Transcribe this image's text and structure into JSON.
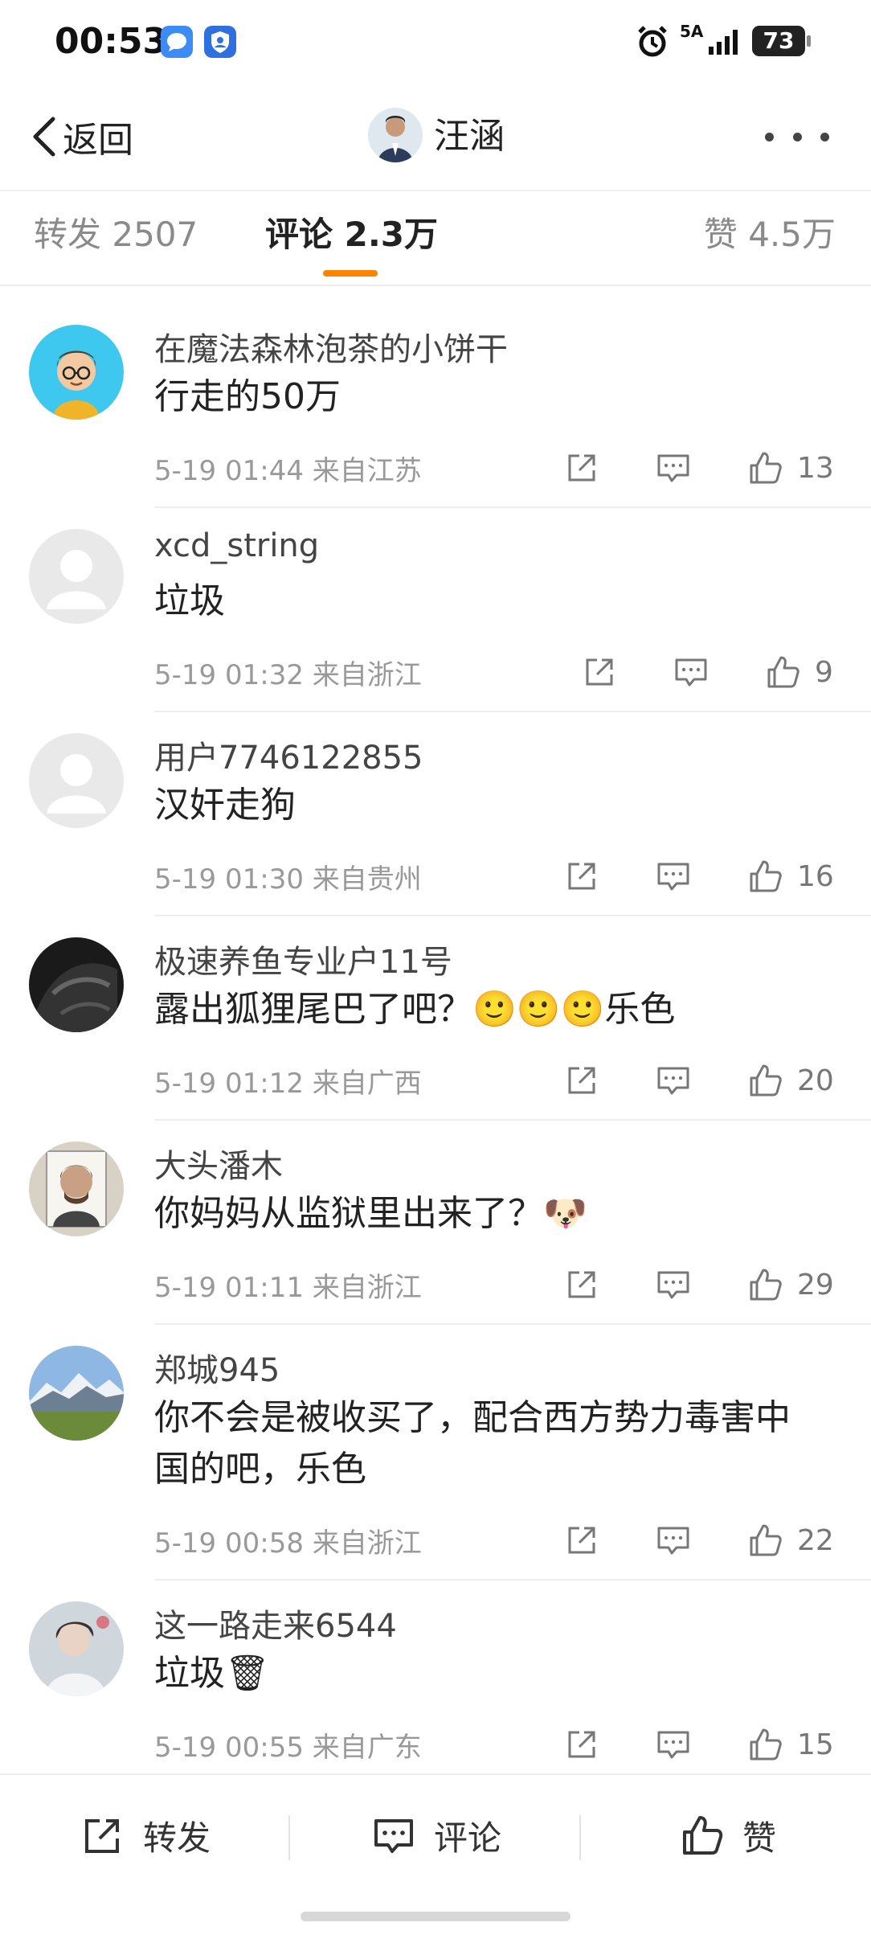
{
  "status_bar": {
    "time": "00:53",
    "network": "5A",
    "battery": "73",
    "icons": [
      "message-app-icon",
      "shield-app-icon",
      "alarm-icon",
      "signal-icon",
      "battery-icon"
    ]
  },
  "nav": {
    "back_label": "返回",
    "title": "汪涵",
    "more_icon": "more-dots-icon"
  },
  "tabs": {
    "repost": "转发 2507",
    "comment": "评论 2.3万",
    "like": "赞 4.5万",
    "active": "comment",
    "accent_color": "#ff8200"
  },
  "comments": [
    {
      "name": "在魔法森林泡茶的小饼干",
      "text": "行走的50万",
      "meta": "5-19 01:44 来自江苏",
      "likes": "13"
    },
    {
      "name": "xcd_string",
      "text": "垃圾",
      "meta": "5-19 01:32 来自浙江",
      "likes": "9"
    },
    {
      "name": "用户7746122855",
      "text": "汉奸走狗",
      "meta": "5-19 01:30 来自贵州",
      "likes": "16"
    },
    {
      "name": "极速养鱼专业户11号",
      "text": "露出狐狸尾巴了吧？🙂🙂🙂乐色",
      "meta": "5-19 01:12 来自广西",
      "likes": "20"
    },
    {
      "name": "大头潘木",
      "text": "你妈妈从监狱里出来了？🐶",
      "meta": "5-19 01:11 来自浙江",
      "likes": "29"
    },
    {
      "name": "郑城945",
      "text": "你不会是被收买了，配合西方势力毒害中国的吧，乐色",
      "meta": "5-19 00:58 来自浙江",
      "likes": "22"
    },
    {
      "name": "这一路走来6544",
      "text": "垃圾🗑",
      "meta": "5-19 00:55 来自广东",
      "likes": "15"
    }
  ],
  "bottom_bar": {
    "repost": "转发",
    "comment": "评论",
    "like": "赞"
  }
}
